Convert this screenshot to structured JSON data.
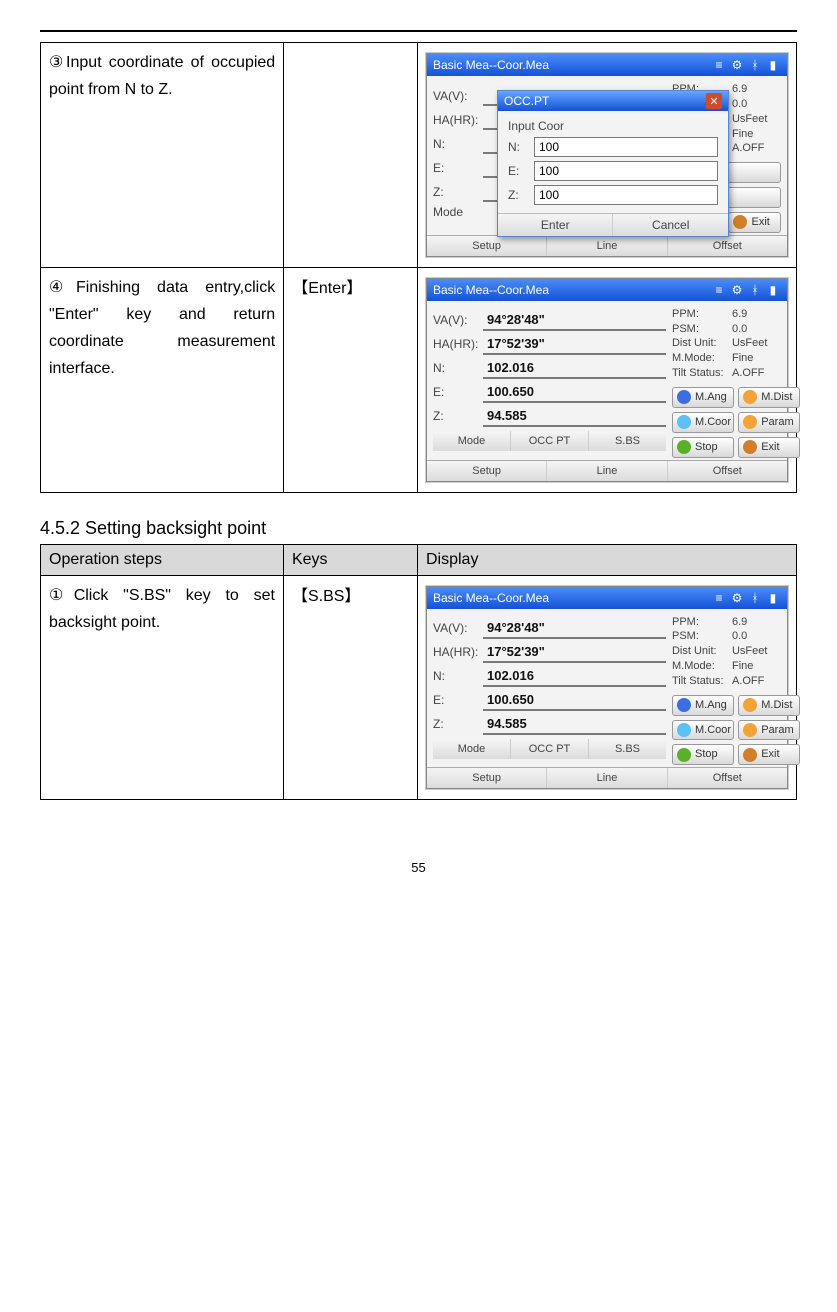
{
  "page_number": "55",
  "section_heading": "4.5.2 Setting backsight point",
  "headers": {
    "steps": "Operation steps",
    "keys": "Keys",
    "display": "Display"
  },
  "row3": {
    "step": "③Input coordinate of occupied point from N to Z.",
    "key": ""
  },
  "row4": {
    "step": "④Finishing data entry,click \"Enter\" key and return coordinate measurement interface.",
    "key": "【Enter】"
  },
  "row5": {
    "step": "①Click \"S.BS\" key to set backsight point.",
    "key": "【S.BS】"
  },
  "app_title": "Basic Mea--Coor.Mea",
  "status": {
    "ppm_l": "PPM:",
    "ppm_v": "6.9",
    "psm_l": "PSM:",
    "psm_v": "0.0",
    "du_l": "Dist Unit:",
    "du_v": "UsFeet",
    "mm_l": "M.Mode:",
    "mm_v": "Fine",
    "ts_l": "Tilt Status:",
    "ts_v": "A.OFF"
  },
  "labels": {
    "vav": "VA(V):",
    "hahr": "HA(HR):",
    "n": "N:",
    "e": "E:",
    "z": "Z:",
    "mode": "Mode"
  },
  "coor_screen": {
    "va": "94°28'48\"",
    "ha": "17°52'39\"",
    "n": "102.016",
    "e": "100.650",
    "z": "94.585"
  },
  "side": {
    "mang": "M.Ang",
    "mdist": "M.Dist",
    "mcoor": "M.Coor",
    "param": "Param",
    "stop": "Stop",
    "exit": "Exit"
  },
  "bar": {
    "setup": "Setup",
    "line": "Line",
    "offset": "Offset",
    "occpt": "OCC PT",
    "sbs": "S.BS"
  },
  "dialog": {
    "title": "OCC.PT",
    "sub": "Input Coor",
    "n": "N:",
    "e": "E:",
    "z": "Z:",
    "vn": "100",
    "ve": "100",
    "vz": "100",
    "enter": "Enter",
    "cancel": "Cancel"
  }
}
